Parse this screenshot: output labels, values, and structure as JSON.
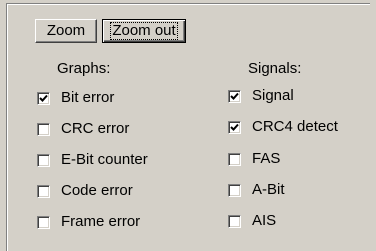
{
  "toolbar": {
    "zoom_label": "Zoom",
    "zoom_out_label": "Zoom out"
  },
  "graphs": {
    "heading": "Graphs:",
    "items": [
      {
        "label": "Bit error",
        "checked": true
      },
      {
        "label": "CRC error",
        "checked": false
      },
      {
        "label": "E-Bit counter",
        "checked": false
      },
      {
        "label": "Code error",
        "checked": false
      },
      {
        "label": "Frame error",
        "checked": false
      }
    ]
  },
  "signals": {
    "heading": "Signals:",
    "items": [
      {
        "label": "Signal",
        "checked": true
      },
      {
        "label": "CRC4 detect",
        "checked": true
      },
      {
        "label": "FAS",
        "checked": false
      },
      {
        "label": "A-Bit",
        "checked": false
      },
      {
        "label": "AIS",
        "checked": false
      }
    ]
  }
}
